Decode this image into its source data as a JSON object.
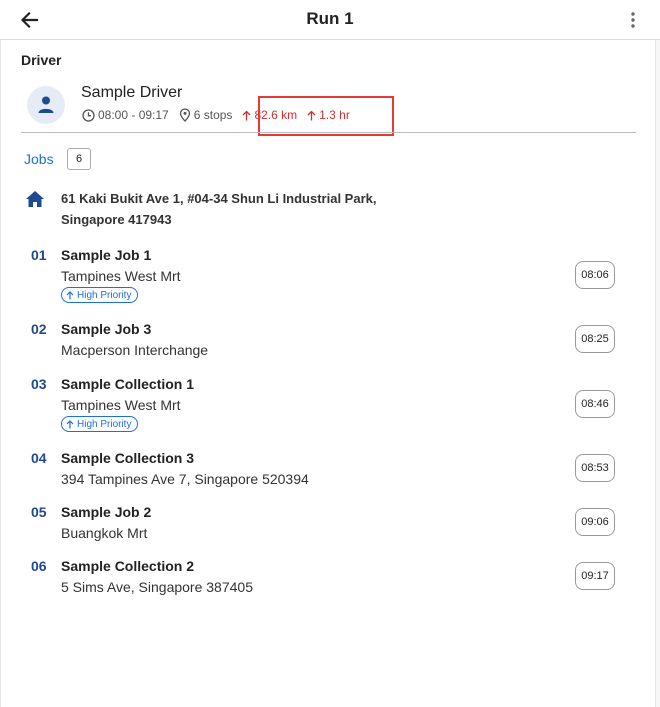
{
  "header": {
    "title": "Run 1",
    "back_icon": "arrow-left-icon",
    "menu_icon": "more-vertical-icon"
  },
  "driver_section": {
    "label": "Driver",
    "name": "Sample Driver",
    "time_range": "08:00 - 09:17",
    "stops": "6 stops",
    "distance": "82.6 km",
    "duration": "1.3 hr",
    "stat_color": "#d32f2f"
  },
  "jobs_section": {
    "tab_label": "Jobs",
    "count": "6",
    "accent_color": "#1e6fd6",
    "depot": {
      "line1": "61 Kaki Bukit Ave 1, #04-34 Shun Li Industrial Park,",
      "line2": "Singapore 417943"
    },
    "jobs": [
      {
        "number": "01",
        "name": "Sample Job 1",
        "address": "Tampines West Mrt",
        "badge": "High Priority",
        "time": "08:06"
      },
      {
        "number": "02",
        "name": "Sample Job 3",
        "address": "Macperson Interchange",
        "badge": "",
        "time": "08:25"
      },
      {
        "number": "03",
        "name": "Sample Collection 1",
        "address": "Tampines West Mrt",
        "badge": "High Priority",
        "time": "08:46"
      },
      {
        "number": "04",
        "name": "Sample Collection 3",
        "address": "394 Tampines Ave 7, Singapore 520394",
        "badge": "",
        "time": "08:53"
      },
      {
        "number": "05",
        "name": "Sample Job 2",
        "address": "Buangkok Mrt",
        "badge": "",
        "time": "09:06"
      },
      {
        "number": "06",
        "name": "Sample Collection 2",
        "address": "5 Sims Ave, Singapore 387405",
        "badge": "",
        "time": "09:17"
      }
    ]
  }
}
